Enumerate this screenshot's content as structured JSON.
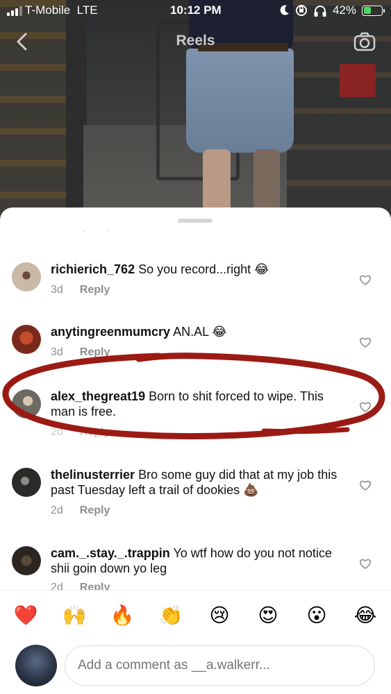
{
  "status_bar": {
    "carrier": "T-Mobile",
    "network": "LTE",
    "time": "10:12 PM",
    "battery_percent": "42%",
    "battery_level": 0.42,
    "icons": [
      "do-not-disturb-icon",
      "orientation-lock-icon",
      "headphones-icon",
      "battery-charging-icon"
    ]
  },
  "header": {
    "title": "Reels",
    "back_icon": "chevron-left-icon",
    "camera_icon": "camera-icon"
  },
  "comments": [
    {
      "username": "richierich_762",
      "text": "So you record...right 😂",
      "age": "3d",
      "reply_label": "Reply"
    },
    {
      "username": "anytingreenmumcry",
      "text": "AN.AL 😂",
      "age": "3d",
      "reply_label": "Reply"
    },
    {
      "username": "alex_thegreat19",
      "text": "Born to shit forced to wipe. This man is free.",
      "age": "2d",
      "reply_label": "Reply"
    },
    {
      "username": "thelinusterrier",
      "text": "Bro some guy did that at my job this past Tuesday left a trail of dookies 💩",
      "age": "2d",
      "reply_label": "Reply"
    },
    {
      "username": "cam._.stay._.trappin",
      "text": "Yo wtf how do you not notice shii goin down yo leg",
      "age": "2d",
      "reply_label": "Reply"
    }
  ],
  "emoji_bar": [
    "❤️",
    "🙌",
    "🔥",
    "👏",
    "😢",
    "😍",
    "😮",
    "😂"
  ],
  "input": {
    "placeholder": "Add a comment as __a.walkerr..."
  },
  "colors": {
    "scribble_red": "#9b1b14",
    "heart_red": "#ed4956",
    "text_secondary": "#8e8e8e"
  }
}
